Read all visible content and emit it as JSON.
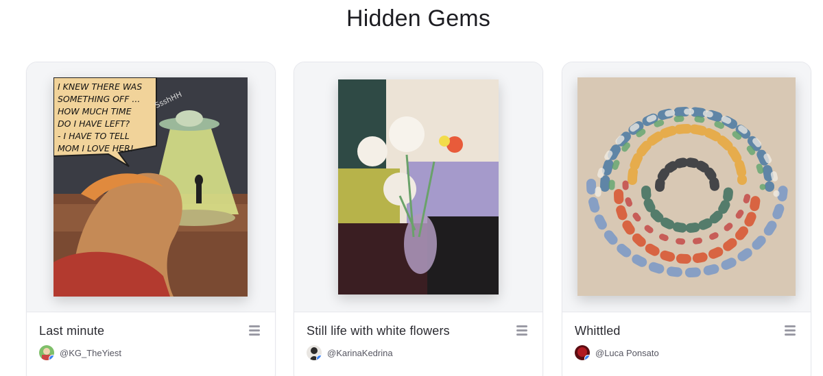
{
  "section": {
    "title": "Hidden Gems"
  },
  "cards": [
    {
      "title": "Last minute",
      "author": "@KG_TheYiest",
      "artwork": "comic-panel-ufo",
      "comic_text": [
        "I KNEW THERE WAS",
        "SOMETHING OFF ...",
        "HOW MUCH TIME",
        "DO I HAVE LEFT?",
        " - I HAVE TO TELL",
        "MOM I LOVE HER!"
      ],
      "sfx_text": "SsshHH"
    },
    {
      "title": "Still life with white flowers",
      "author": "@KarinaKedrina",
      "artwork": "still-life-painting"
    },
    {
      "title": "Whittled",
      "author": "@Luca Ponsato",
      "artwork": "abstract-swirl-painting"
    }
  ],
  "icons": {
    "menu": "hamburger-menu-icon",
    "verified": "verified-badge-icon"
  },
  "colors": {
    "accent_band": "#e4e2fb",
    "verified": "#3b82f6",
    "card_border": "#e6e7ec",
    "media_bg": "#f4f5f7"
  }
}
